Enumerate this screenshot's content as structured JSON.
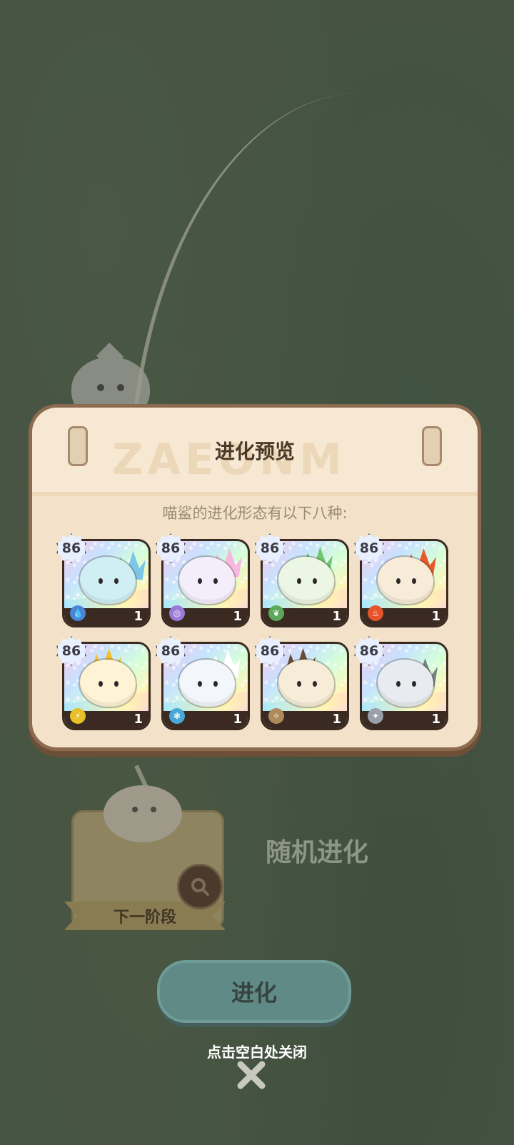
{
  "modal": {
    "title": "进化预览",
    "subtitle": "喵鲨的进化形态有以下八种:",
    "watermark": "ZAEONM"
  },
  "evolutions": [
    {
      "level": "86",
      "count": "1",
      "element": "water",
      "body_color": "#cfeff5",
      "crest_color": "#7cc7e8",
      "icon_color": "#4a86d8",
      "icon_glyph": "💧"
    },
    {
      "level": "86",
      "count": "1",
      "element": "psychic",
      "body_color": "#f4eefb",
      "crest_color": "#f6b9de",
      "icon_color": "#9a7ad8",
      "icon_glyph": "◎"
    },
    {
      "level": "86",
      "count": "1",
      "element": "grass",
      "body_color": "#ecf6e4",
      "crest_color": "#74c772",
      "icon_color": "#5aa85a",
      "icon_glyph": "❦"
    },
    {
      "level": "86",
      "count": "1",
      "element": "fire",
      "body_color": "#f8ecd8",
      "crest_color": "#e85a2a",
      "icon_color": "#e8542a",
      "icon_glyph": "♨"
    },
    {
      "level": "86",
      "count": "1",
      "element": "electric",
      "body_color": "#fff3d6",
      "crest_color": "#f4c02a",
      "icon_color": "#e8c02a",
      "icon_glyph": "⚡"
    },
    {
      "level": "86",
      "count": "1",
      "element": "wind",
      "body_color": "#f3f6fb",
      "crest_color": "#ffffff",
      "icon_color": "#4aa8d8",
      "icon_glyph": "❃"
    },
    {
      "level": "86",
      "count": "1",
      "element": "earth",
      "body_color": "#f6ecd8",
      "crest_color": "#6a4a34",
      "icon_color": "#b08a5a",
      "icon_glyph": "✧"
    },
    {
      "level": "86",
      "count": "1",
      "element": "normal",
      "body_color": "#e8ecf0",
      "crest_color": "#7a8088",
      "icon_color": "#9aa0a8",
      "icon_glyph": "✦"
    }
  ],
  "stage": {
    "label": "下一阶段"
  },
  "random_label": "随机进化",
  "evolve_button": "进化",
  "close_hint": "点击空白处关闭",
  "colors": {
    "modal_bg": "#f3e2c9",
    "modal_border": "#8b6a4f",
    "evolve_button": "#5f8a86"
  }
}
